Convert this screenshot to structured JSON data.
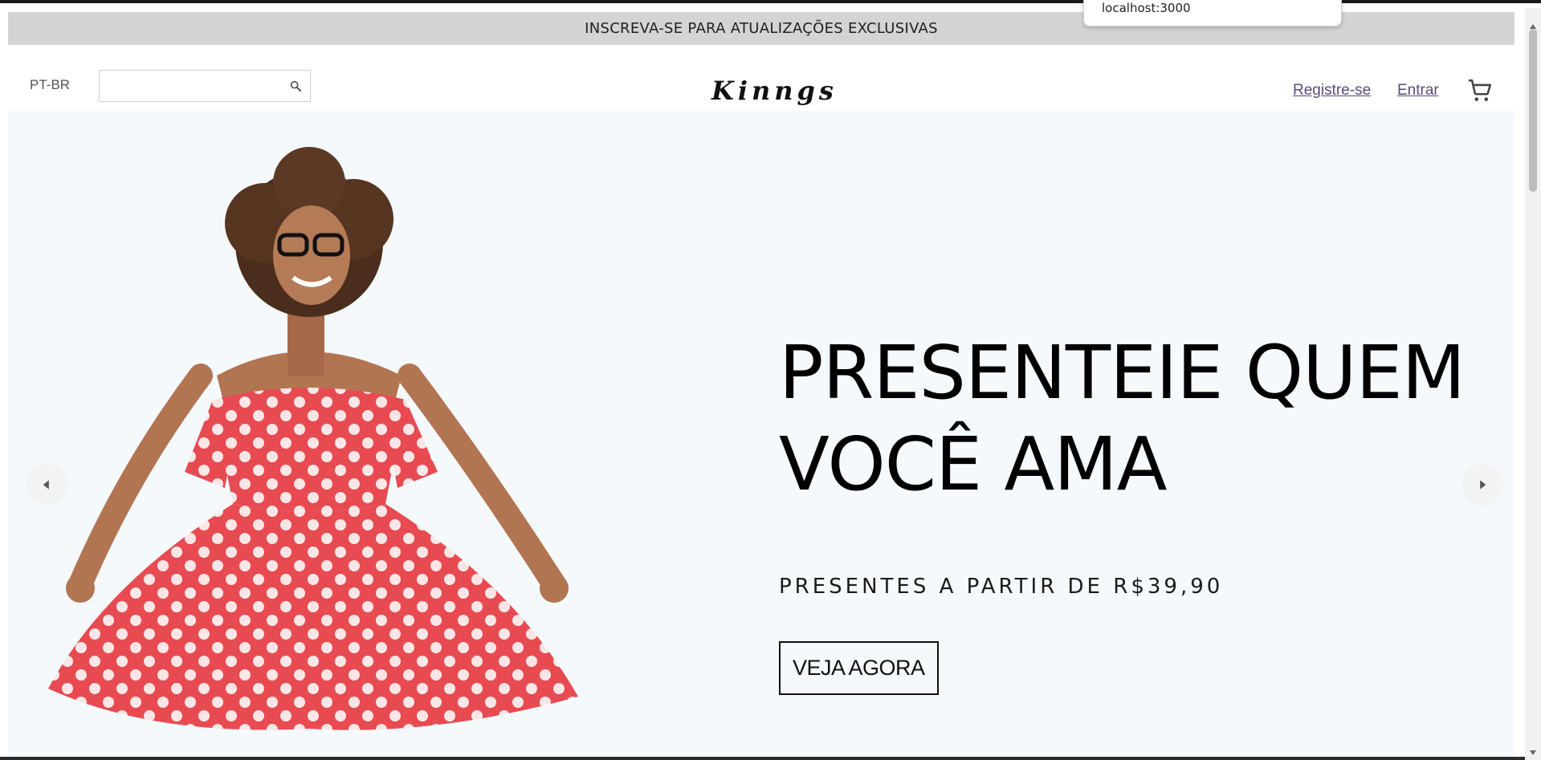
{
  "browser": {
    "popup_url": "localhost:3000"
  },
  "announcement": {
    "text": "INSCREVA-SE PARA ATUALIZAÇÕES EXCLUSIVAS"
  },
  "header": {
    "language": "PT-BR",
    "search": {
      "value": "",
      "placeholder": "",
      "icon": "search-icon"
    },
    "logo": "Kinngs",
    "register_label": "Registre-se",
    "login_label": "Entrar",
    "cart_icon": "cart-icon"
  },
  "hero": {
    "title_line1": "PRESENTEIE QUEM",
    "title_line2": "VOCÊ AMA",
    "subtitle": "PRESENTES A PARTIR DE R$39,90",
    "cta_label": "VEJA AGORA",
    "background_color": "#f5f9fb",
    "prev_icon": "arrow-left-icon",
    "next_icon": "arrow-right-icon"
  },
  "colors": {
    "announcement_bg": "#d4d4d4",
    "link_color": "#5a4a7a",
    "dress_red": "#e84a52"
  }
}
